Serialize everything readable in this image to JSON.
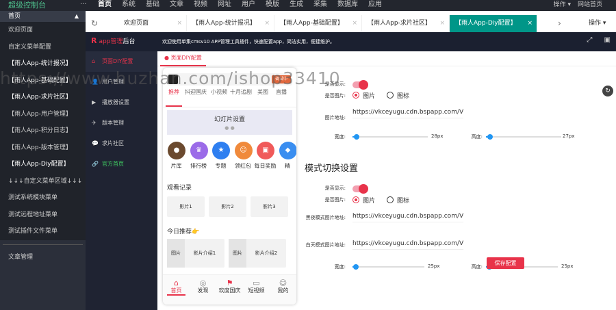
{
  "topbar": {
    "logo": "超级控制台",
    "dots": "···",
    "nav": [
      "首页",
      "系统",
      "基础",
      "文章",
      "视频",
      "网址",
      "用户",
      "模版",
      "生成",
      "采集",
      "数据库",
      "应用"
    ],
    "active_nav": "首页",
    "right": [
      "操作 ▾",
      "网站首页"
    ]
  },
  "sidebar": {
    "head": "首页",
    "items": [
      "欢迎页面",
      "自定义菜单配置",
      "【雨人App-统计报况】",
      "【雨人App-基础配置】",
      "【雨人App-求片社区】",
      "【雨人App-用户管理】",
      "【雨人App-积分日志】",
      "【雨人App-版本管理】",
      "【雨人App-Diy配置】",
      "↓↓↓自定义菜单区域↓↓↓",
      "测试系统模块菜单",
      "测试远程地址菜单",
      "测试插件文件菜单"
    ],
    "bottom": "文章管理"
  },
  "tabbar": {
    "tabs": [
      "欢迎页面",
      "【雨人App-统计报况】",
      "【雨人App-基础配置】",
      "【雨人App-求片社区】",
      "【雨人App-Diy配置】"
    ],
    "ops": "操作 ▾"
  },
  "app": {
    "logo_mark": "R",
    "logo_text_a": "app管理",
    "logo_text_b": "后台",
    "desc": "欢迎使用单集cmsv10 APP管理工具插件，快速配置app，简洁实用，便捷维护。",
    "menu": [
      {
        "icon": "⌂",
        "label": "页面DIY配置"
      },
      {
        "icon": "👤",
        "label": "用户管理"
      },
      {
        "icon": "▶",
        "label": "播放器设置"
      },
      {
        "icon": "✈",
        "label": "版本管理"
      },
      {
        "icon": "💬",
        "label": "求片社区"
      },
      {
        "icon": "🔗",
        "label": "官方首页"
      }
    ],
    "page_tab": "● 页面DIY配置",
    "refresh": "↻"
  },
  "phone": {
    "search_badge": "调试中",
    "cats": [
      "推荐",
      "抖迎国庆",
      "小视频",
      "十月追剧",
      "美图",
      "直播"
    ],
    "carousel_title": "幻灯片设置",
    "carousel_dots": "● ●",
    "grid": [
      {
        "label": "片库",
        "color": "#6b4a2f"
      },
      {
        "label": "排行榜",
        "color": "#9b6be8"
      },
      {
        "label": "专题",
        "color": "#2f7ff0"
      },
      {
        "label": "领红包",
        "color": "#f08a3c"
      },
      {
        "label": "每日奖励",
        "color": "#f05a5a"
      },
      {
        "label": "精",
        "color": "#3a8ef0"
      }
    ],
    "history_title": "观看记录",
    "history": [
      "影片1",
      "影片2",
      "影片3"
    ],
    "rec_title": "今日推荐👉",
    "rec": [
      {
        "img": "图片",
        "title": "影片介绍1"
      },
      {
        "img": "图片",
        "title": "影片介绍2"
      }
    ],
    "nav": [
      {
        "icon": "⌂",
        "label": "首页"
      },
      {
        "icon": "◎",
        "label": "发现"
      },
      {
        "icon": "⚑",
        "label": "欢度国庆"
      },
      {
        "icon": "▭",
        "label": "短视频"
      },
      {
        "icon": "☺",
        "label": "我的"
      }
    ]
  },
  "form": {
    "show_label": "是否显示:",
    "img_label": "是否图片:",
    "radio_img": "图片",
    "radio_icon": "图标",
    "img_url_label": "图片地址:",
    "img_url": "https://vkceyugu.cdn.bspapp.com/VI",
    "width_label": "宽度:",
    "height_label": "高度:",
    "w1": "28px",
    "h1": "27px",
    "w1_frac": 0.05,
    "h1_frac": 0.05,
    "section_title": "模式切换设置",
    "night_label": "黑夜模式图片地址:",
    "night_url": "https://vkceyugu.cdn.bspapp.com/VI",
    "day_label": "白天模式图片地址:",
    "day_url": "https://vkceyugu.cdn.bspapp.com/VI",
    "w2": "25px",
    "h2": "25px",
    "w2_frac": 0.05,
    "h2_frac": 0.05,
    "save": "保存配置"
  },
  "watermark": "https://www.huzhan.com/ishop33410"
}
